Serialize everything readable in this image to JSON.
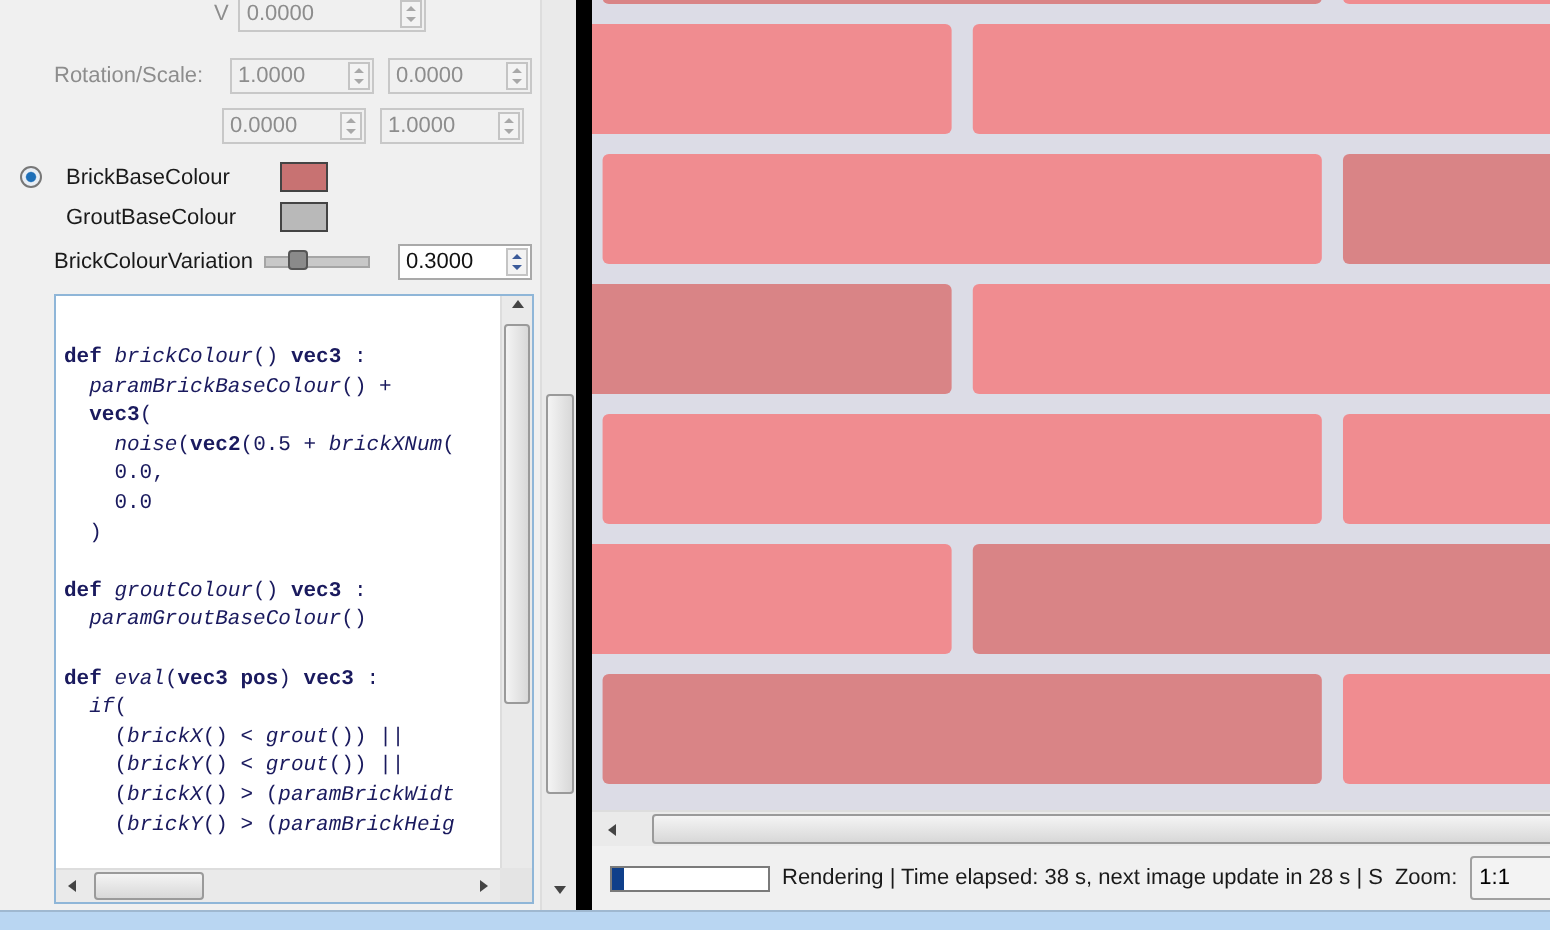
{
  "transform": {
    "v_label": "V",
    "v_field": {
      "value": "0.0000",
      "disabled": true
    },
    "rotation_label": "Rotation/Scale:",
    "rotation_fields": [
      {
        "value": "1.0000",
        "disabled": true
      },
      {
        "value": "0.0000",
        "disabled": true
      },
      {
        "value": "0.0000",
        "disabled": true
      },
      {
        "value": "1.0000",
        "disabled": true
      }
    ]
  },
  "colour_params": [
    {
      "label": "BrickBaseColour",
      "color": "#c87272",
      "selected": true
    },
    {
      "label": "GroutBaseColour",
      "color": "#b9b9b9",
      "selected": false
    }
  ],
  "variation": {
    "label": "BrickColourVariation",
    "level": 0.3,
    "field": {
      "value": "0.3000",
      "disabled": false
    }
  },
  "code_blocks": [
    [
      "**def** *brickColour*() **vec3** :",
      "  *paramBrickBaseColour*() +",
      "  **vec3**(",
      "    *noise*(**vec2**(0.5 + *brickXNum*(",
      "    0.0,",
      "    0.0",
      "  )"
    ],
    [
      "**def** *groutColour*() **vec3** :",
      "  *paramGroutBaseColour*()"
    ],
    [
      "**def** *eval*(**vec3 pos**) **vec3** :",
      "  *if*(",
      "    (*brickX*() < *grout*()) ||",
      "    (*brickY*() < *grout*()) ||",
      "    (*brickX*() > (*paramBrickWidt*",
      "    (*brickY*() > (*paramBrickHeig*"
    ]
  ],
  "status_bar": {
    "progress": {
      "level": 0.08
    },
    "message": "Rendering | Time elapsed: 38 s, next image update in 28 s | S",
    "zoom_label": "Zoom:",
    "zoom_value": "1:1"
  }
}
